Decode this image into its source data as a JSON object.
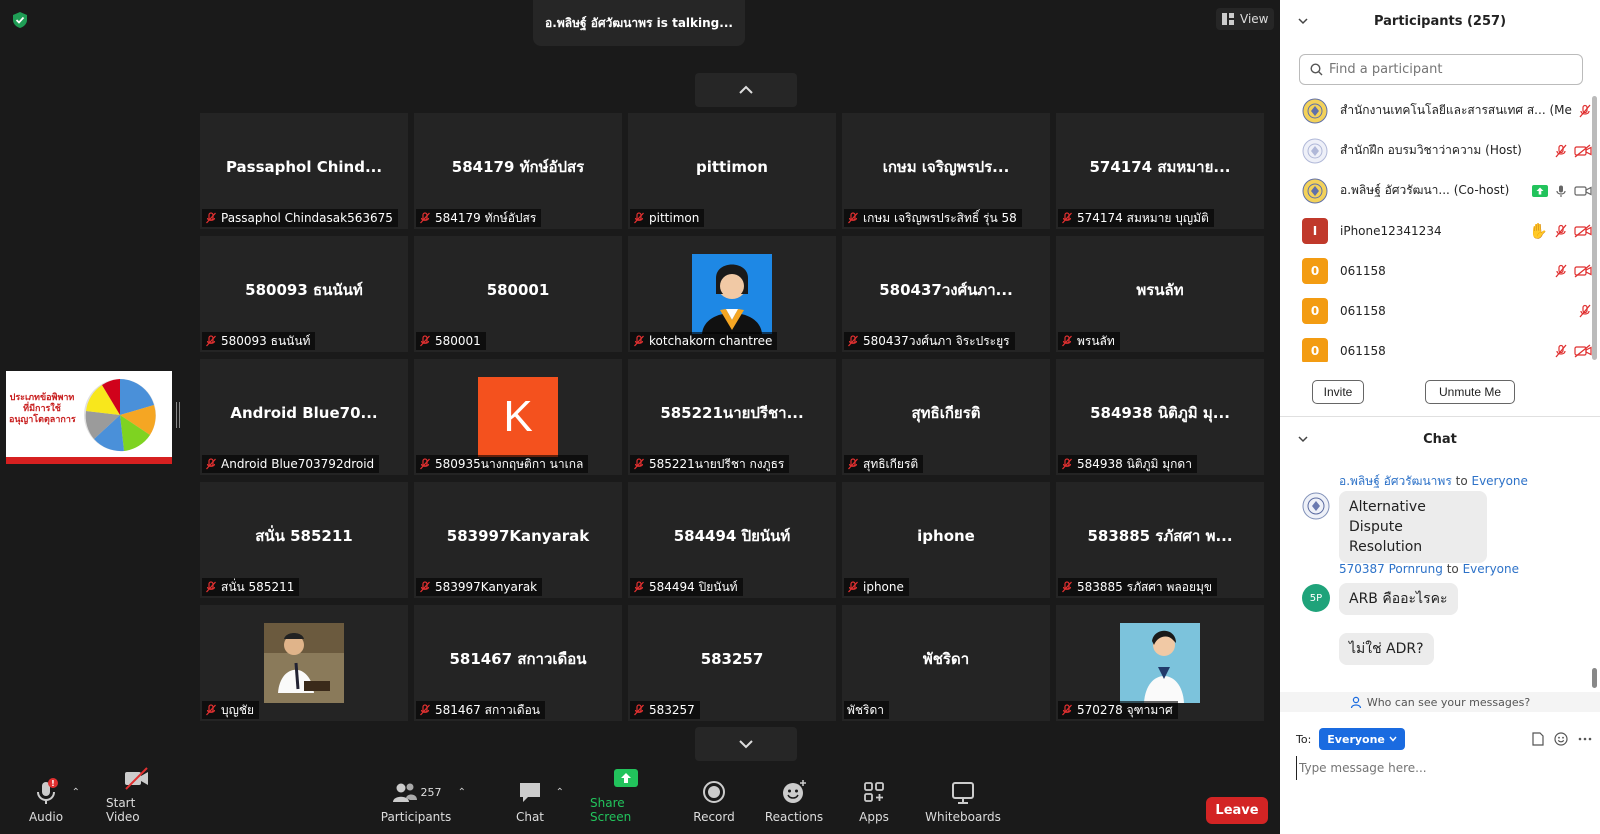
{
  "meeting": {
    "talking_text": "อ.พลิษฐ์ อัศวัฒนาพร is talking...",
    "view_label": "View",
    "share_thumb_text": "ประเภทข้อพิพาทที่มีการใช้อนุญาโตตุลาการ"
  },
  "tiles": [
    {
      "big": "Passaphol  Chind...",
      "label": "Passaphol Chindasak563675",
      "muted": true
    },
    {
      "big": "584179 ทักษ์อัปสร",
      "label": "584179 ทักษ์อัปสร",
      "muted": true
    },
    {
      "big": "pittimon",
      "label": "pittimon",
      "muted": true
    },
    {
      "big": "เกษม เจริญพรปร...",
      "label": "เกษม เจริญพรประสิทธิ์ รุ่น 58",
      "muted": true
    },
    {
      "big": "574174 สมหมาย...",
      "label": "574174 สมหมาย บุญมัติ",
      "muted": true
    },
    {
      "big": "580093 ธนนันท์",
      "label": "580093 ธนนันท์",
      "muted": true
    },
    {
      "big": "580001",
      "label": "580001",
      "muted": true
    },
    {
      "big": "",
      "label": "kotchakorn chantree",
      "muted": true,
      "photo": "graduate"
    },
    {
      "big": "580437วงศ์นภา...",
      "label": "580437วงศ์นภา จิระประยูร",
      "muted": true
    },
    {
      "big": "พรนลัท",
      "label": "พรนลัท",
      "muted": true
    },
    {
      "big": "Android  Blue70...",
      "label": "Android Blue703792droid",
      "muted": true
    },
    {
      "big": "",
      "label": "580935นางกฤษติกา นาเกล",
      "muted": true,
      "photo": "letter",
      "letter": "K"
    },
    {
      "big": "585221นายปรีชา...",
      "label": "585221นายปรีชา กงภูธร",
      "muted": true
    },
    {
      "big": "สุทธิเกียรติ",
      "label": "สุทธิเกียรติ",
      "muted": true
    },
    {
      "big": "584938  นิติภูมิ  มุ...",
      "label": "584938 นิติภูมิ  มุกดา",
      "muted": true
    },
    {
      "big": "สนั่น 585211",
      "label": "สนั่น 585211",
      "muted": true
    },
    {
      "big": "583997Kanyarak",
      "label": "583997Kanyarak",
      "muted": true
    },
    {
      "big": "584494 ปิยนันท์",
      "label": "584494 ปิยนันท์",
      "muted": true
    },
    {
      "big": "iphone",
      "label": "iphone",
      "muted": true
    },
    {
      "big": "583885 รภัสศา พ...",
      "label": "583885 รภัสศา พลอยมุข",
      "muted": true
    },
    {
      "big": "",
      "label": "บุญชัย",
      "muted": true,
      "photo": "man"
    },
    {
      "big": "581467 สกาวเดือน",
      "label": "581467 สกาวเดือน",
      "muted": true
    },
    {
      "big": "583257",
      "label": "583257",
      "muted": true
    },
    {
      "big": "พัชริดา",
      "label": "พัชริดา",
      "muted": false
    },
    {
      "big": "",
      "label": "570278 จุฑามาศ",
      "muted": true,
      "photo": "woman"
    }
  ],
  "toolbar": {
    "audio": "Audio",
    "start_video": "Start Video",
    "participants": "Participants",
    "participant_count": "257",
    "chat": "Chat",
    "share_screen": "Share Screen",
    "record": "Record",
    "reactions": "Reactions",
    "apps": "Apps",
    "whiteboards": "Whiteboards",
    "leave": "Leave"
  },
  "participants_panel": {
    "title": "Participants (257)",
    "search_placeholder": "Find a participant",
    "invite": "Invite",
    "unmute_me": "Unmute Me",
    "rows": [
      {
        "name": "สำนักงานเทคโนโลยีและสารสนเทศ ส...",
        "role": "(Me)",
        "avatar": "emblem",
        "icons": "mic-muted"
      },
      {
        "name": "สำนักฝึก อบรมวิชาว่าความ",
        "role": "(Host)",
        "avatar": "emblem-light",
        "icons": "mic-muted video-off"
      },
      {
        "name": "อ.พลิษฐ์ อัศวรัฒนา...",
        "role": "(Co-host)",
        "avatar": "emblem",
        "icons": "share mic video"
      },
      {
        "name": "iPhone12341234",
        "role": "",
        "avatar": "I",
        "avatar_color": "#c0392b",
        "icons": "hand mic-muted video-off"
      },
      {
        "name": "061158",
        "role": "",
        "avatar": "0",
        "avatar_color": "#f39c12",
        "icons": "mic-muted video-off"
      },
      {
        "name": "061158",
        "role": "",
        "avatar": "0",
        "avatar_color": "#f39c12",
        "icons": "mic-muted"
      },
      {
        "name": "061158",
        "role": "",
        "avatar": "0",
        "avatar_color": "#f39c12",
        "icons": "mic-muted video-off"
      }
    ]
  },
  "chat_panel": {
    "title": "Chat",
    "messages": [
      {
        "sender": "อ.พลิษฐ์ อัศวรัฒนาพร",
        "to_word": "to",
        "recipient": "Everyone",
        "bubbles": [
          "Alternative Dispute Resolution"
        ]
      },
      {
        "sender": "570387 Pornrung",
        "to_word": "to",
        "recipient": "Everyone",
        "avatar_text": "5P",
        "bubbles": [
          "ARB คืออะไรคะ",
          "ไม่ใช่ ADR?"
        ]
      }
    ],
    "who_can_see": "Who can see your messages?",
    "to_label": "To:",
    "to_value": "Everyone",
    "input_placeholder": "Type message here..."
  },
  "colors": {
    "accent_blue": "#1a6be0",
    "leave_red": "#d32424",
    "share_green": "#22c35c",
    "mute_red": "#e03030"
  }
}
